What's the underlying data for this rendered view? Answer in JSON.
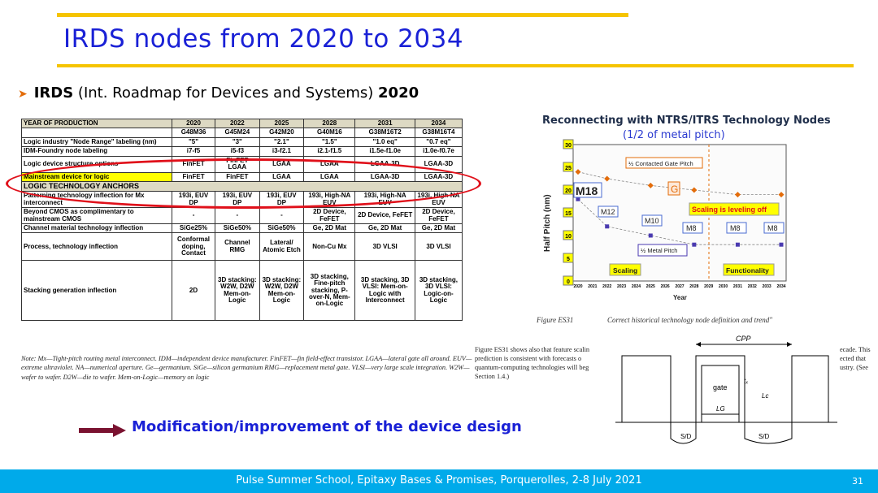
{
  "slide": {
    "title": "IRDS nodes from 2020 to 2034",
    "bullet_bold": "IRDS",
    "bullet_text": " (Int. Roadmap for Devices and Systems) ",
    "bullet_year": "2020",
    "modification": "Modification/improvement of the device design",
    "footer": "Pulse Summer School, Epitaxy Bases & Promises, Porquerolles, 2-8 July 2021",
    "page_number": "31"
  },
  "table": {
    "header": [
      "YEAR OF PRODUCTION",
      "2020",
      "2022",
      "2025",
      "2028",
      "2031",
      "2034"
    ],
    "node_codes": [
      "",
      "G48M36",
      "G45M24",
      "G42M20",
      "G40M16",
      "G38M16T2",
      "G38M16T4"
    ],
    "rows": [
      [
        "Logic industry \"Node Range\" labeling (nm)",
        "\"5\"",
        "\"3\"",
        "\"2.1\"",
        "\"1.5\"",
        "\"1.0 eq\"",
        "\"0.7 eq\""
      ],
      [
        "IDM-Foundry node labeling",
        "i7-f5",
        "i5-f3",
        "i3-f2.1",
        "i2.1-f1.5",
        "i1.5e-f1.0e",
        "i1.0e-f0.7e"
      ],
      [
        "Logic device structure options",
        "FinFET",
        "FinFET LGAA",
        "LGAA",
        "LGAA",
        "LGAA-3D",
        "LGAA-3D"
      ],
      [
        "Mainstream device for logic",
        "FinFET",
        "FinFET",
        "LGAA",
        "LGAA",
        "LGAA-3D",
        "LGAA-3D"
      ]
    ],
    "anchors_label": "LOGIC TECHNOLOGY ANCHORS",
    "anchor_rows": [
      [
        "Patterning technology inflection for Mx interconnect",
        "193i, EUV DP",
        "193i, EUV DP",
        "193i, EUV DP",
        "193i, High-NA EUV",
        "193i, High-NA EUV",
        "193i, High-NA EUV"
      ],
      [
        "Beyond CMOS as complimentary to mainstream CMOS",
        "-",
        "-",
        "-",
        "2D Device, FeFET",
        "2D Device, FeFET",
        "2D Device, FeFET"
      ],
      [
        "Channel material technology inflection",
        "SiGe25%",
        "SiGe50%",
        "SiGe50%",
        "Ge, 2D Mat",
        "Ge, 2D Mat",
        "Ge, 2D Mat"
      ],
      [
        "Process, technology inflection",
        "Conformal doping, Contact",
        "Channel RMG",
        "Lateral/ Atomic Etch",
        "Non-Cu Mx",
        "3D VLSI",
        "3D VLSI"
      ],
      [
        "Stacking generation inflection",
        "2D",
        "3D stacking: W2W, D2W Mem-on-Logic",
        "3D stacking: W2W, D2W Mem-on-Logic",
        "3D stacking, Fine-pitch stacking, P-over-N, Mem-on-Logic",
        "3D stacking, 3D VLSI: Mem-on-Logic with Interconnect",
        "3D stacking, 3D VLSI: Logic-on-Logic"
      ]
    ],
    "note": "Note: Mx—Tight-pitch routing metal interconnect.  IDM—independent device manufacturer.  FinFET—fin field-effect transistor. LGAA—lateral gate all around.  EUV—extreme ultraviolet.  NA—numerical aperture.  Ge—germanium.  SiGe—silicon germanium RMG—replacement metal gate.  VLSI—very large scale integration.  W2W—wafer to wafer.  D2W—die to wafer. Mem-on-Logic—memory on logic"
  },
  "chart_data": {
    "type": "scatter",
    "title": "Reconnecting with NTRS/ITRS Technology Nodes",
    "subtitle": "(1/2 of metal pitch)",
    "ylabel": "Half Pitch (nm)",
    "xlabel": "Year",
    "x_ticks": [
      "2020",
      "2021",
      "2022",
      "2023",
      "2024",
      "2025",
      "2026",
      "2027",
      "2028",
      "2029",
      "2030",
      "2031",
      "2032",
      "2033",
      "2034"
    ],
    "y_ticks": [
      "0",
      "5",
      "10",
      "15",
      "20",
      "25",
      "30"
    ],
    "ylim": [
      0,
      30
    ],
    "series": [
      {
        "name": "½ Contacted Gate Pitch",
        "color": "#e36c0a",
        "x": [
          2020,
          2022,
          2025,
          2028,
          2031,
          2034
        ],
        "y": [
          24,
          22.5,
          21,
          20,
          19,
          19
        ]
      },
      {
        "name": "½ Metal Pitch",
        "color": "#4a3ab0",
        "x": [
          2020,
          2022,
          2025,
          2028,
          2031,
          2034
        ],
        "y": [
          18,
          12,
          10,
          8,
          8,
          8
        ]
      }
    ],
    "annotations": {
      "m18": "M18",
      "m12": "M12",
      "m10": "M10",
      "m8": "M8",
      "g": "G",
      "leveling": "Scaling is leveling off",
      "scaling": "Scaling",
      "functionality": "Functionality",
      "cgp": "½ Contacted Gate Pitch",
      "mp": "½ Metal Pitch"
    }
  },
  "figure": {
    "number": "Figure ES31",
    "caption": "Correct historical technology node definition and trend\""
  },
  "paragraph": {
    "left": "Figure ES31 shows also that feature scalin\nprediction is consistent with forecasts o\nquantum-computing technologies will beg\nSection 1.4.)",
    "right": "ecade. This\nected that\nustry. (See"
  },
  "device": {
    "cpp": "CPP",
    "gate": "gate",
    "tox": "tₓ",
    "lc": "Lc",
    "lg": "LG",
    "sd": "S/D"
  }
}
